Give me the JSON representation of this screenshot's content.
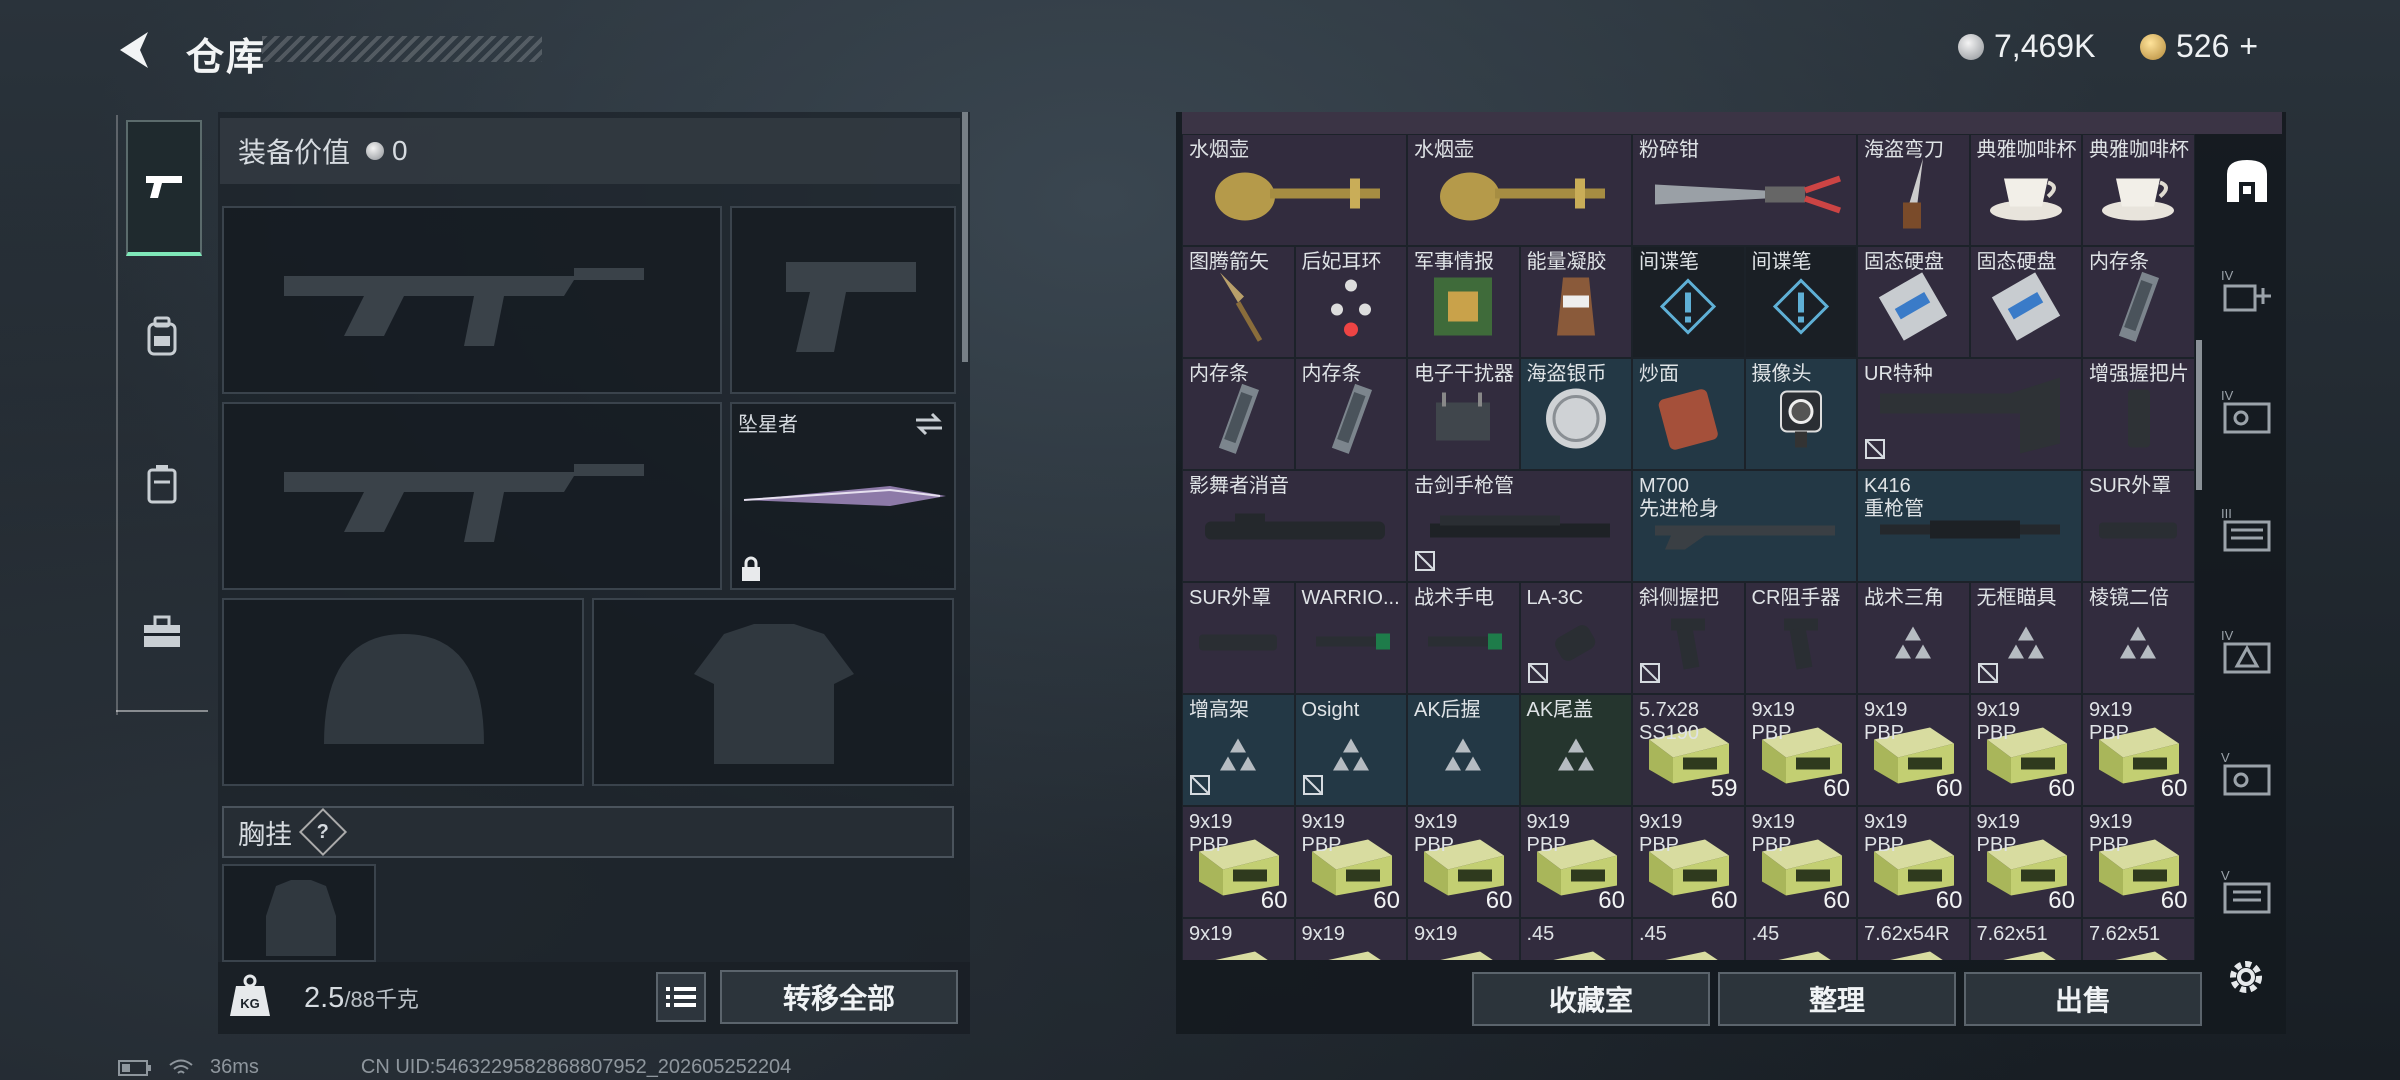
{
  "header": {
    "title": "仓库"
  },
  "currency": {
    "silver": "7,469K",
    "gold": "526",
    "gold_plus": "+"
  },
  "equipment": {
    "value_label": "装备价值",
    "value": "0",
    "melee_name": "坠星者",
    "chest_label": "胸挂",
    "chest_help": "?"
  },
  "footer_left": {
    "weight": "2.5",
    "capacity": "/88千克",
    "transfer_all": "转移全部"
  },
  "footer_right": {
    "collection": "收藏室",
    "sort": "整理",
    "sell": "出售"
  },
  "status": {
    "ping": "36ms",
    "uid": "CN UID:5463229582868807952_202605252204"
  },
  "side_tabs": {
    "tab3": "IV",
    "tab4": "IV",
    "tab5": "III",
    "tab6": "IV",
    "tab7": "V"
  },
  "inventory": [
    {
      "label": "水烟壶",
      "icon": "hookah-icon",
      "col": 0,
      "row": 0,
      "w": 2,
      "tint": "purple"
    },
    {
      "label": "水烟壶",
      "icon": "hookah-icon",
      "col": 2,
      "row": 0,
      "w": 2,
      "tint": "purple"
    },
    {
      "label": "粉碎钳",
      "icon": "pliers-icon",
      "col": 4,
      "row": 0,
      "w": 2,
      "tint": "purple"
    },
    {
      "label": "海盗弯刀",
      "icon": "dagger-icon",
      "col": 6,
      "row": 0,
      "w": 1,
      "tint": "purple"
    },
    {
      "label": "典雅咖啡杯",
      "icon": "teacup-icon",
      "col": 7,
      "row": 0,
      "w": 1,
      "tint": "purple"
    },
    {
      "label": "典雅咖啡杯",
      "icon": "teacup-icon",
      "col": 8,
      "row": 0,
      "w": 1,
      "tint": "purple"
    },
    {
      "label": "图腾箭矢",
      "icon": "arrowhead-icon",
      "col": 0,
      "row": 1,
      "w": 1,
      "tint": "purple"
    },
    {
      "label": "后妃耳环",
      "icon": "earring-icon",
      "col": 1,
      "row": 1,
      "w": 1,
      "tint": "purple"
    },
    {
      "label": "军事情报",
      "icon": "circuit-icon",
      "col": 2,
      "row": 1,
      "w": 1,
      "tint": "purple"
    },
    {
      "label": "能量凝胶",
      "icon": "gel-icon",
      "col": 3,
      "row": 1,
      "w": 1,
      "tint": "purple"
    },
    {
      "label": "间谍笔",
      "icon": "spy-pen-icon",
      "col": 4,
      "row": 1,
      "w": 1,
      "tint": "dark"
    },
    {
      "label": "间谍笔",
      "icon": "spy-pen-icon",
      "col": 5,
      "row": 1,
      "w": 1,
      "tint": "dark"
    },
    {
      "label": "固态硬盘",
      "icon": "ssd-icon",
      "col": 6,
      "row": 1,
      "w": 1,
      "tint": "purple"
    },
    {
      "label": "固态硬盘",
      "icon": "ssd-icon",
      "col": 7,
      "row": 1,
      "w": 1,
      "tint": "purple"
    },
    {
      "label": "内存条",
      "icon": "ram-icon",
      "col": 8,
      "row": 1,
      "w": 1,
      "tint": "purple"
    },
    {
      "label": "内存条",
      "icon": "ram-icon",
      "col": 0,
      "row": 2,
      "w": 1,
      "tint": "purple"
    },
    {
      "label": "内存条",
      "icon": "ram-icon",
      "col": 1,
      "row": 2,
      "w": 1,
      "tint": "purple"
    },
    {
      "label": "电子干扰器",
      "icon": "jammer-icon",
      "col": 2,
      "row": 2,
      "w": 1,
      "tint": "purple"
    },
    {
      "label": "海盗银币",
      "icon": "coin-icon",
      "col": 3,
      "row": 2,
      "w": 1,
      "tint": "blue"
    },
    {
      "label": "炒面",
      "icon": "noodle-icon",
      "col": 4,
      "row": 2,
      "w": 1,
      "tint": "blue"
    },
    {
      "label": "摄像头",
      "icon": "camera-icon",
      "col": 5,
      "row": 2,
      "w": 1,
      "tint": "blue"
    },
    {
      "label": "UR特种",
      "icon": "stock-icon",
      "col": 6,
      "row": 2,
      "w": 2,
      "tint": "purple",
      "nopic": true
    },
    {
      "label": "增强握把片",
      "icon": "grip-plate-icon",
      "col": 8,
      "row": 2,
      "w": 1,
      "tint": "purple"
    },
    {
      "label": "影舞者消音",
      "icon": "suppressor-icon",
      "col": 0,
      "row": 3,
      "w": 2,
      "tint": "purple"
    },
    {
      "label": "击剑手枪管",
      "icon": "barrel-icon",
      "col": 2,
      "row": 3,
      "w": 2,
      "tint": "purple",
      "nopic": true
    },
    {
      "label": "M700\n先进枪身",
      "icon": "rifle-body-icon",
      "col": 4,
      "row": 3,
      "w": 2,
      "tint": "blue"
    },
    {
      "label": "K416\n重枪管",
      "icon": "heavy-barrel-icon",
      "col": 6,
      "row": 3,
      "w": 2,
      "tint": "blue"
    },
    {
      "label": "SUR外罩",
      "icon": "handguard-icon",
      "col": 8,
      "row": 3,
      "w": 1,
      "tint": "purple"
    },
    {
      "label": "SUR外罩",
      "icon": "handguard-icon",
      "col": 0,
      "row": 4,
      "w": 1,
      "tint": "purple"
    },
    {
      "label": "WARRIO...",
      "icon": "flashlight-icon",
      "col": 1,
      "row": 4,
      "w": 1,
      "tint": "purple"
    },
    {
      "label": "战术手电",
      "icon": "flashlight-icon",
      "col": 2,
      "row": 4,
      "w": 1,
      "tint": "purple"
    },
    {
      "label": "LA-3C",
      "icon": "laser-icon",
      "col": 3,
      "row": 4,
      "w": 1,
      "tint": "purple",
      "nopic": true
    },
    {
      "label": "斜侧握把",
      "icon": "foregrip-icon",
      "col": 4,
      "row": 4,
      "w": 1,
      "tint": "purple",
      "nopic": true
    },
    {
      "label": "CR阻手器",
      "icon": "foregrip-icon",
      "col": 5,
      "row": 4,
      "w": 1,
      "tint": "purple"
    },
    {
      "label": "战术三角",
      "icon": "tri-icon",
      "col": 6,
      "row": 4,
      "w": 1,
      "tint": "purple"
    },
    {
      "label": "无框瞄具",
      "icon": "tri-icon",
      "col": 7,
      "row": 4,
      "w": 1,
      "tint": "purple",
      "nopic": true
    },
    {
      "label": "棱镜二倍",
      "icon": "tri-icon",
      "col": 8,
      "row": 4,
      "w": 1,
      "tint": "purple"
    },
    {
      "label": "增高架",
      "icon": "tri-icon",
      "col": 0,
      "row": 5,
      "w": 1,
      "tint": "blue",
      "nopic": true
    },
    {
      "label": "Osight",
      "icon": "tri-icon",
      "col": 1,
      "row": 5,
      "w": 1,
      "tint": "blue",
      "nopic": true
    },
    {
      "label": "AK后握",
      "icon": "tri-icon",
      "col": 2,
      "row": 5,
      "w": 1,
      "tint": "blue"
    },
    {
      "label": "AK尾盖",
      "icon": "tri-icon",
      "col": 3,
      "row": 5,
      "w": 1,
      "tint": "green"
    },
    {
      "label": "5.7x28\nSS190",
      "icon": "ammo-box-icon",
      "col": 4,
      "row": 5,
      "w": 1,
      "tint": "purple",
      "count": "59"
    },
    {
      "label": "9x19\nPBP",
      "icon": "ammo-box-icon",
      "col": 5,
      "row": 5,
      "w": 1,
      "tint": "purple",
      "count": "60"
    },
    {
      "label": "9x19\nPBP",
      "icon": "ammo-box-icon",
      "col": 6,
      "row": 5,
      "w": 1,
      "tint": "purple",
      "count": "60"
    },
    {
      "label": "9x19\nPBP",
      "icon": "ammo-box-icon",
      "col": 7,
      "row": 5,
      "w": 1,
      "tint": "purple",
      "count": "60"
    },
    {
      "label": "9x19\nPBP",
      "icon": "ammo-box-icon",
      "col": 8,
      "row": 5,
      "w": 1,
      "tint": "purple",
      "count": "60"
    },
    {
      "label": "9x19\nPBP",
      "icon": "ammo-box-icon",
      "col": 0,
      "row": 6,
      "w": 1,
      "tint": "purple",
      "count": "60"
    },
    {
      "label": "9x19\nPBP",
      "icon": "ammo-box-icon",
      "col": 1,
      "row": 6,
      "w": 1,
      "tint": "purple",
      "count": "60"
    },
    {
      "label": "9x19\nPBP",
      "icon": "ammo-box-icon",
      "col": 2,
      "row": 6,
      "w": 1,
      "tint": "purple",
      "count": "60"
    },
    {
      "label": "9x19\nPBP",
      "icon": "ammo-box-icon",
      "col": 3,
      "row": 6,
      "w": 1,
      "tint": "purple",
      "count": "60"
    },
    {
      "label": "9x19\nPBP",
      "icon": "ammo-box-icon",
      "col": 4,
      "row": 6,
      "w": 1,
      "tint": "purple",
      "count": "60"
    },
    {
      "label": "9x19\nPBP",
      "icon": "ammo-box-icon",
      "col": 5,
      "row": 6,
      "w": 1,
      "tint": "purple",
      "count": "60"
    },
    {
      "label": "9x19\nPBP",
      "icon": "ammo-box-icon",
      "col": 6,
      "row": 6,
      "w": 1,
      "tint": "purple",
      "count": "60"
    },
    {
      "label": "9x19\nPBP",
      "icon": "ammo-box-icon",
      "col": 7,
      "row": 6,
      "w": 1,
      "tint": "purple",
      "count": "60"
    },
    {
      "label": "9x19\nPBP",
      "icon": "ammo-box-icon",
      "col": 8,
      "row": 6,
      "w": 1,
      "tint": "purple",
      "count": "60"
    },
    {
      "label": "9x19",
      "icon": "ammo-box-icon",
      "col": 0,
      "row": 7,
      "w": 1,
      "tint": "purple"
    },
    {
      "label": "9x19",
      "icon": "ammo-box-icon",
      "col": 1,
      "row": 7,
      "w": 1,
      "tint": "purple"
    },
    {
      "label": "9x19",
      "icon": "ammo-box-icon",
      "col": 2,
      "row": 7,
      "w": 1,
      "tint": "purple"
    },
    {
      "label": ".45",
      "icon": "ammo-box-icon",
      "col": 3,
      "row": 7,
      "w": 1,
      "tint": "purple"
    },
    {
      "label": ".45",
      "icon": "ammo-box-icon",
      "col": 4,
      "row": 7,
      "w": 1,
      "tint": "purple"
    },
    {
      "label": ".45",
      "icon": "ammo-box-icon",
      "col": 5,
      "row": 7,
      "w": 1,
      "tint": "purple"
    },
    {
      "label": "7.62x54R",
      "icon": "ammo-box-icon",
      "col": 6,
      "row": 7,
      "w": 1,
      "tint": "purple"
    },
    {
      "label": "7.62x51",
      "icon": "ammo-box-icon",
      "col": 7,
      "row": 7,
      "w": 1,
      "tint": "purple"
    },
    {
      "label": "7.62x51",
      "icon": "ammo-box-icon",
      "col": 8,
      "row": 7,
      "w": 1,
      "tint": "purple"
    }
  ]
}
